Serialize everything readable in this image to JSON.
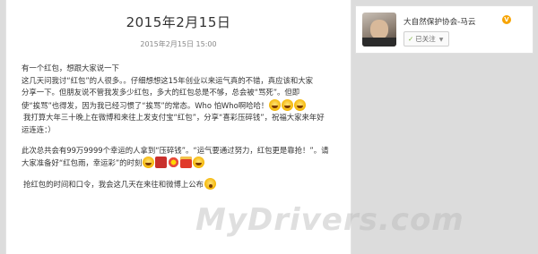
{
  "post": {
    "title": "2015年2月15日",
    "date": "2015年2月15日 15:00",
    "lines": [
      "有一个红包，想跟大家说一下",
      "这几天问我讨“红包”的人很多。。仔细想想这15年创业以来运气真的不错，真应该和大家",
      "分享一下。但朋友说不管我发多少红包，多大的红包总是不够，总会被“骂死”。但即",
      "使“挨骂”也得发，因为我已经习惯了“挨骂”的常态。Who 怕Who啊哈哈！",
      " 我打算大年三十晚上在微博和来往上发支付宝“红包”，分享“喜彩压碎钱”，祝福大家来年好",
      "运连连：）",
      "此次总共会有99万9999个幸运的人拿到“压碎钱”。“运气要通过努力，红包更是靠抢！”。请",
      "大家准备好“红包雨，幸运彩”的时刻",
      " 抢红包的时间和口令，我会这几天在来往和微博上公布"
    ],
    "emoticons": [
      "laugh-emoticon",
      "laugh-emoticon",
      "laugh-emoticon",
      "heart-emoticon",
      "flower-emoticon",
      "red-packet-emoticon",
      "laugh-emoticon",
      "surprised-emoticon"
    ]
  },
  "profile": {
    "name": "大自然保护协会-马云",
    "verified": "V",
    "follow_label": "已关注",
    "check_icon": "✓",
    "caret_icon": "▼"
  },
  "watermark": "MyDrivers.com",
  "colors": {
    "page_bg": "#dcdcdc",
    "card_bg": "#ffffff",
    "verified_badge": "#f7a400",
    "follow_check": "#7bb33a"
  }
}
